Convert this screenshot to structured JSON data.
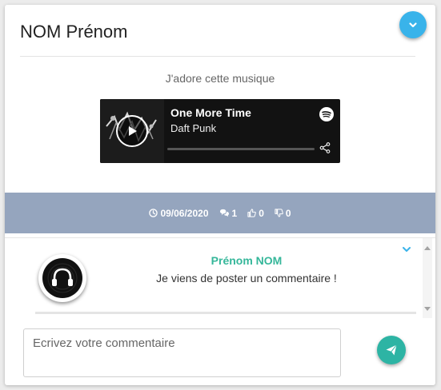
{
  "post": {
    "author": "NOM Prénom",
    "caption": "J'adore cette musique",
    "toggle_icon": "chevron-down-icon"
  },
  "player": {
    "track_title": "One More Time",
    "artist": "Daft Punk",
    "icons": {
      "play": "play-icon",
      "brand": "spotify-icon",
      "share": "share-icon"
    }
  },
  "stats": {
    "date": "09/06/2020",
    "comments": "1",
    "likes": "0",
    "dislikes": "0"
  },
  "comment": {
    "author": "Prénom NOM",
    "text": "Je viens de poster un commentaire !"
  },
  "composer": {
    "placeholder": "Ecrivez votre commentaire",
    "send_icon": "paper-plane-icon"
  },
  "colors": {
    "accent_blue": "#39b3ea",
    "accent_teal": "#2db4a4",
    "stats_bar": "#95a5be",
    "comment_author": "#35b79a"
  }
}
